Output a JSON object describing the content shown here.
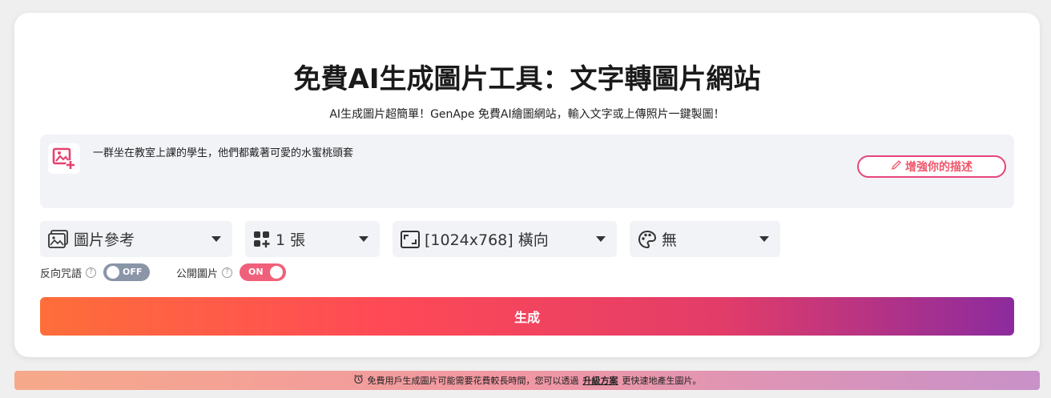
{
  "header": {
    "title": "免費AI生成圖片工具：文字轉圖片網站",
    "subtitle": "AI生成圖片超簡單！GenApe 免費AI繪圖網站，輸入文字或上傳照片一鍵製圖！"
  },
  "prompt": {
    "text": "一群坐在教室上課的學生，他們都戴著可愛的水蜜桃頭套",
    "upload_icon": "image-add-icon",
    "enhance_label": "增強你的描述",
    "enhance_icon": "pencil-icon"
  },
  "options": {
    "reference": {
      "label": "圖片參考",
      "icon": "image-gallery-icon"
    },
    "count": {
      "label": "1 張",
      "icon": "grid-add-icon"
    },
    "size": {
      "label": "[1024x768] 橫向",
      "icon": "aspect-ratio-icon"
    },
    "style": {
      "label": "無",
      "icon": "palette-icon"
    }
  },
  "toggles": {
    "negative_prompt": {
      "label": "反向咒語",
      "state": "OFF"
    },
    "public_image": {
      "label": "公開圖片",
      "state": "ON"
    }
  },
  "generate_label": "生成",
  "notice": {
    "text_before": "免費用戶生成圖片可能需要花費較長時間，您可以透過",
    "link": "升級方案",
    "text_after": "更快速地產生圖片。",
    "icon": "alarm-icon"
  },
  "colors": {
    "accent": "#f0566b",
    "toggle_off": "#8a95a8",
    "toggle_on": "#f0607a"
  }
}
